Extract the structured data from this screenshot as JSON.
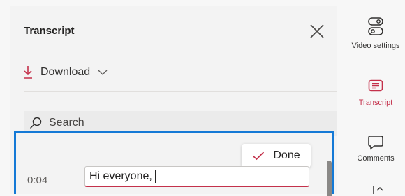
{
  "panel": {
    "title": "Transcript",
    "download_label": "Download",
    "search_placeholder": "Search",
    "done_label": "Done",
    "entries": [
      {
        "time": "0:04",
        "text": "Hi everyone,"
      }
    ]
  },
  "rail": {
    "items": [
      {
        "label": "Video settings",
        "icon": "video-settings-icon",
        "active": false
      },
      {
        "label": "Transcript",
        "icon": "transcript-icon",
        "active": true
      },
      {
        "label": "Comments",
        "icon": "comments-icon",
        "active": false
      }
    ]
  },
  "colors": {
    "accent": "#c4314b",
    "focus_border": "#1479d6"
  }
}
